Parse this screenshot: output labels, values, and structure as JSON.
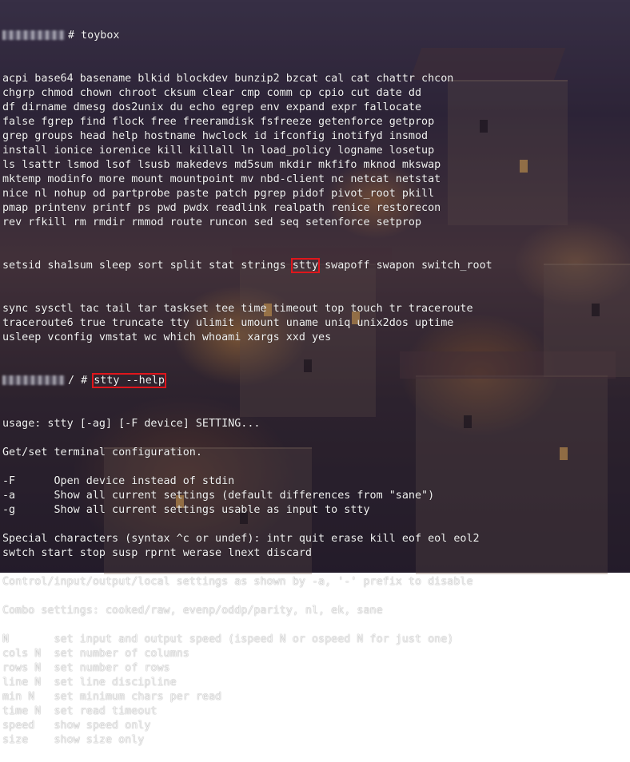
{
  "terminal": {
    "commands": {
      "toybox": "# toybox",
      "stty_prompt": "/ #",
      "stty_cmd": "stty --help"
    },
    "toybox_lines": [
      "acpi base64 basename blkid blockdev bunzip2 bzcat cal cat chattr chcon",
      "chgrp chmod chown chroot cksum clear cmp comm cp cpio cut date dd",
      "df dirname dmesg dos2unix du echo egrep env expand expr fallocate",
      "false fgrep find flock free freeramdisk fsfreeze getenforce getprop",
      "grep groups head help hostname hwclock id ifconfig inotifyd insmod",
      "install ionice iorenice kill killall ln load_policy logname losetup",
      "ls lsattr lsmod lsof lsusb makedevs md5sum mkdir mkfifo mknod mkswap",
      "mktemp modinfo more mount mountpoint mv nbd-client nc netcat netstat",
      "nice nl nohup od partprobe paste patch pgrep pidof pivot_root pkill",
      "pmap printenv printf ps pwd pwdx readlink realpath renice restorecon",
      "rev rfkill rm rmdir rmmod route runcon sed seq setenforce setprop"
    ],
    "setsid_line": {
      "before": "setsid sha1sum sleep sort split stat strings ",
      "highlight": "stty",
      "after": " swapoff swapon switch_root"
    },
    "toybox_lines_after": [
      "sync sysctl tac tail tar taskset tee time timeout top touch tr traceroute",
      "traceroute6 true truncate tty ulimit umount uname uniq unix2dos uptime",
      "usleep vconfig vmstat wc which whoami xargs xxd yes"
    ],
    "help_lines": [
      "usage: stty [-ag] [-F device] SETTING...",
      "",
      "Get/set terminal configuration.",
      "",
      "-F      Open device instead of stdin",
      "-a      Show all current settings (default differences from \"sane\")",
      "-g      Show all current settings usable as input to stty",
      "",
      "Special characters (syntax ^c or undef): intr quit erase kill eof eol eol2",
      "swtch start stop susp rprnt werase lnext discard",
      "",
      "Control/input/output/local settings as shown by -a, '-' prefix to disable",
      "",
      "Combo settings: cooked/raw, evenp/oddp/parity, nl, ek, sane",
      "",
      "N       set input and output speed (ispeed N or ospeed N for just one)",
      "cols N  set number of columns",
      "rows N  set number of rows",
      "line N  set line discipline",
      "min N   set minimum chars per read",
      "time N  set read timeout",
      "speed   show speed only",
      "size    show size only"
    ],
    "highlight_color": "#e0161c"
  }
}
